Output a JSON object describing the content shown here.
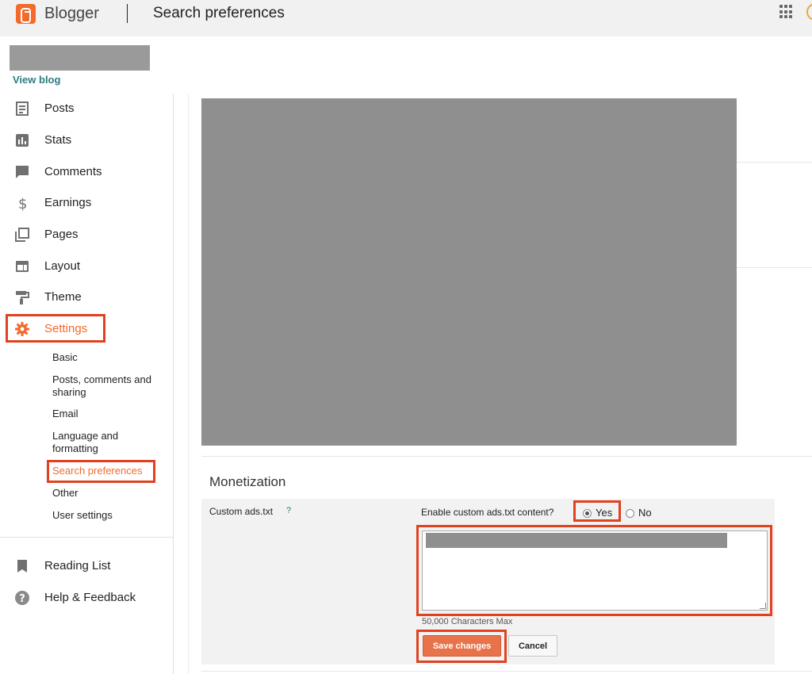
{
  "header": {
    "brand": "Blogger",
    "title": "Search preferences",
    "apps_icon": "apps-grid-icon",
    "avatar_icon": "account-avatar"
  },
  "blog": {
    "view_blog": "View blog"
  },
  "sidebar": {
    "items": [
      {
        "label": "Posts",
        "icon": "posts-icon"
      },
      {
        "label": "Stats",
        "icon": "stats-icon"
      },
      {
        "label": "Comments",
        "icon": "comments-icon"
      },
      {
        "label": "Earnings",
        "icon": "dollar-icon"
      },
      {
        "label": "Pages",
        "icon": "pages-icon"
      },
      {
        "label": "Layout",
        "icon": "layout-icon"
      },
      {
        "label": "Theme",
        "icon": "paint-roller-icon"
      },
      {
        "label": "Settings",
        "icon": "gear-icon"
      }
    ],
    "settings_sub": [
      "Basic",
      "Posts, comments and sharing",
      "Email",
      "Language and formatting",
      "Search preferences",
      "Other",
      "User settings"
    ],
    "bottom": [
      {
        "label": "Reading List",
        "icon": "bookmark-icon"
      },
      {
        "label": "Help & Feedback",
        "icon": "help-icon"
      }
    ]
  },
  "monetization": {
    "title": "Monetization",
    "field_label": "Custom ads.txt",
    "help": "?",
    "enable_label": "Enable custom ads.txt content?",
    "yes": "Yes",
    "no": "No",
    "selected": "Yes",
    "char_max": "50,000 Characters Max",
    "save": "Save changes",
    "cancel": "Cancel"
  },
  "colors": {
    "accent": "#f26a2c",
    "highlight": "#e0411f",
    "link": "#2a7c83"
  }
}
